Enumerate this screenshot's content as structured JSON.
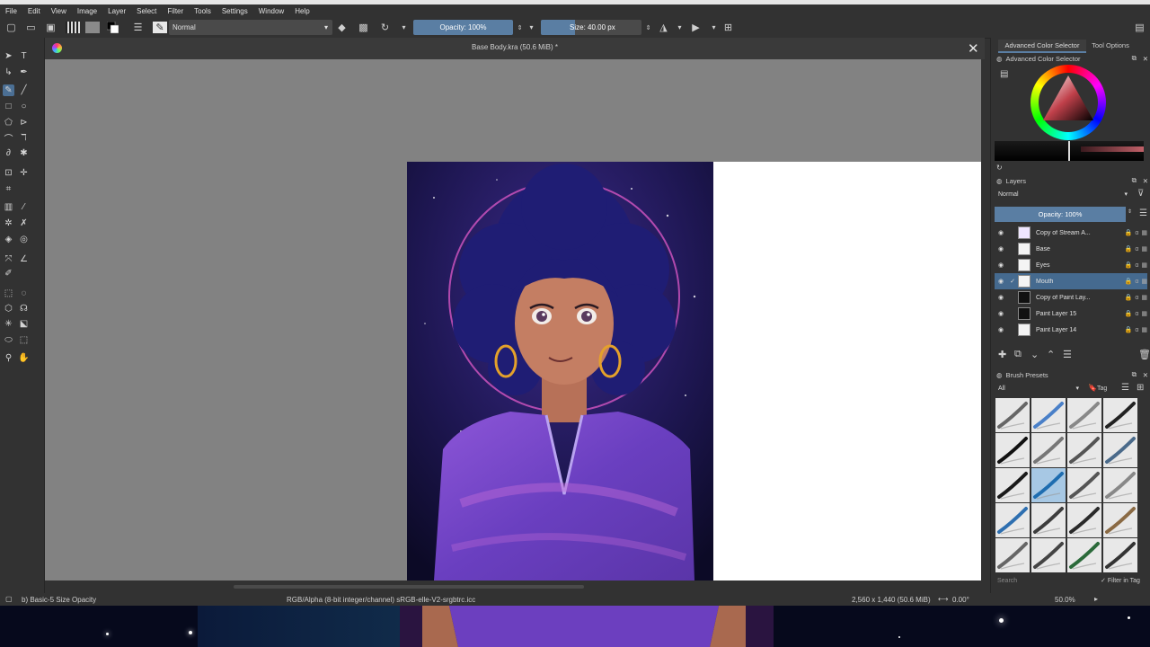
{
  "menu": [
    "File",
    "Edit",
    "View",
    "Image",
    "Layer",
    "Select",
    "Filter",
    "Tools",
    "Settings",
    "Window",
    "Help"
  ],
  "toolbar": {
    "blend_mode": "Normal",
    "opacity": "Opacity: 100%",
    "size": "Size: 40.00 px"
  },
  "document": {
    "title": "Base Body.kra (50.6 MiB) *"
  },
  "docker": {
    "tabs": [
      "Advanced Color Selector",
      "Tool Options"
    ],
    "color_selector_title": "Advanced Color Selector",
    "layers_title": "Layers",
    "layers_blend": "Normal",
    "layers_opacity": "Opacity:  100%",
    "layers": [
      {
        "name": "Copy of Stream A...",
        "selected": false
      },
      {
        "name": "Base",
        "selected": false
      },
      {
        "name": "Eyes",
        "selected": false
      },
      {
        "name": "Mouth",
        "selected": true
      },
      {
        "name": "Copy of Paint Lay...",
        "selected": false
      },
      {
        "name": "Paint Layer 15",
        "selected": false
      },
      {
        "name": "Paint Layer 14",
        "selected": false
      }
    ],
    "brush_presets_title": "Brush Presets",
    "brush_filter": "All",
    "brush_tag": "Tag",
    "search_placeholder": "Search",
    "filter_in_tag": "Filter in Tag"
  },
  "status": {
    "brush": "b) Basic-5 Size Opacity",
    "color_space": "RGB/Alpha (8-bit integer/channel)  sRGB-elle-V2-srgbtrc.icc",
    "dimensions": "2,560 x 1,440 (50.6 MiB)",
    "rotation": "0.00°",
    "zoom": "50.0%"
  },
  "colors": {
    "accent": "#5a7ea3",
    "selection": "#456a8f",
    "hair": "#1e1c6e",
    "shirt": "#7b45c8"
  }
}
